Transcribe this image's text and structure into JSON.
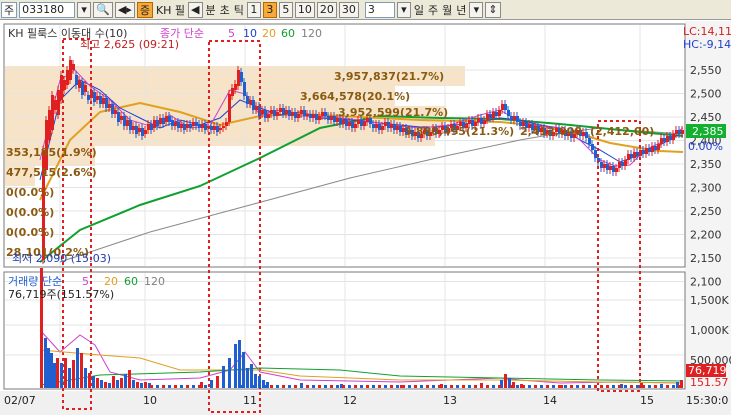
{
  "toolbar": {
    "type_label": "주",
    "code": "033180",
    "stock_name": "KH 필",
    "tabs": [
      "분",
      "초",
      "틱"
    ],
    "intervals": [
      "1",
      "3",
      "5",
      "10",
      "20",
      "30"
    ],
    "active_interval": "3",
    "period_value": "3",
    "periods": [
      "일",
      "주",
      "월",
      "년"
    ]
  },
  "price_panel": {
    "legend_title": "KH 필룩스 이동대 수(10)",
    "legend_ma_prefix": "종가 단순",
    "ma_periods": [
      "5",
      "10",
      "20",
      "60",
      "120"
    ],
    "ma_colors": [
      "#d040d0",
      "#2040d0",
      "#e0a020",
      "#10a030",
      "#808080"
    ],
    "high_annotation": "최고 2,625 (09:21)",
    "low_annotation": "최저 2,090 (15:03)",
    "lc_label": "LC:14,11",
    "hc_label": "HC:-9,14",
    "current_price": "2,385",
    "zero_pct": "0.00%",
    "y_ticks": [
      "2,550",
      "2,500",
      "2,450",
      "2,400",
      "2,350",
      "2,300",
      "2,250",
      "2,200",
      "2,150",
      "2,100"
    ],
    "volume_profile_right": [
      "3,957,837(21.7%)",
      "3,664,578(20.1%)",
      "3,952,599(21.7%)",
      "3,880,495(21.3%)",
      "2,412,000"
    ],
    "volume_profile_left": [
      "353,185(1.9%)",
      "477,515(2.6%)",
      "0(0.0%)",
      "0(0.0%)",
      "0(0.0%)",
      "28,101(0.2%)"
    ],
    "overlap_label": "(2,412,00)"
  },
  "volume_panel": {
    "legend": "거래량 단순",
    "ma_periods": [
      "5",
      "20",
      "60",
      "120"
    ],
    "current_volume_text": "76,719주(151.57%)",
    "y_ticks": [
      "1,500K",
      "1,000K",
      "500,000"
    ],
    "current_volume_badge": "76,719",
    "pct_badge": "151.57"
  },
  "x_axis": {
    "labels": [
      "02/07",
      "10",
      "11",
      "12",
      "13",
      "14",
      "15",
      "15:30:0"
    ]
  },
  "colors": {
    "up": "#e02020",
    "down": "#1f5fd0",
    "profile_fill": "#f5dfc0",
    "highlight_box": "#e02020"
  }
}
